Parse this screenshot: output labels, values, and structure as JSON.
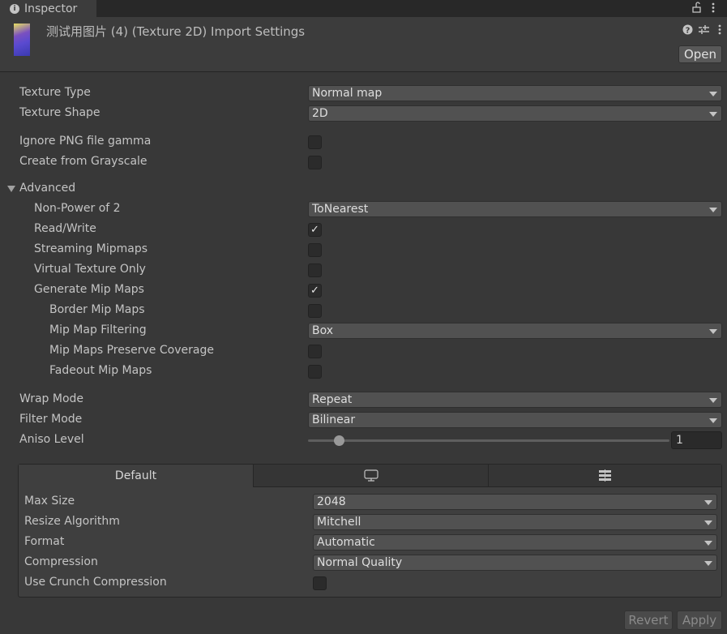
{
  "tab": {
    "title": "Inspector"
  },
  "header": {
    "title": "测试用图片 (4) (Texture 2D) Import Settings",
    "open_label": "Open"
  },
  "fields": {
    "texture_type": {
      "label": "Texture Type",
      "value": "Normal map"
    },
    "texture_shape": {
      "label": "Texture Shape",
      "value": "2D"
    },
    "ignore_png_gamma": {
      "label": "Ignore PNG file gamma",
      "checked": false
    },
    "create_from_grayscale": {
      "label": "Create from Grayscale",
      "checked": false
    },
    "advanced": {
      "label": "Advanced"
    },
    "non_power_of_2": {
      "label": "Non-Power of 2",
      "value": "ToNearest"
    },
    "read_write": {
      "label": "Read/Write",
      "checked": true,
      "mark": "✓"
    },
    "streaming_mipmaps": {
      "label": "Streaming Mipmaps",
      "checked": false
    },
    "virtual_texture_only": {
      "label": "Virtual Texture Only",
      "checked": false
    },
    "generate_mip_maps": {
      "label": "Generate Mip Maps",
      "checked": true,
      "mark": "✓"
    },
    "border_mip_maps": {
      "label": "Border Mip Maps",
      "checked": false
    },
    "mip_map_filtering": {
      "label": "Mip Map Filtering",
      "value": "Box"
    },
    "mip_maps_preserve_coverage": {
      "label": "Mip Maps Preserve Coverage",
      "checked": false
    },
    "fadeout_mip_maps": {
      "label": "Fadeout Mip Maps",
      "checked": false
    },
    "wrap_mode": {
      "label": "Wrap Mode",
      "value": "Repeat"
    },
    "filter_mode": {
      "label": "Filter Mode",
      "value": "Bilinear"
    },
    "aniso_level": {
      "label": "Aniso Level",
      "value": "1",
      "min": 0,
      "max": 16
    }
  },
  "platform": {
    "tabs": [
      {
        "label": "Default"
      },
      {
        "icon": "monitor-icon"
      },
      {
        "icon": "server-icon"
      }
    ],
    "max_size": {
      "label": "Max Size",
      "value": "2048"
    },
    "resize_algorithm": {
      "label": "Resize Algorithm",
      "value": "Mitchell"
    },
    "format": {
      "label": "Format",
      "value": "Automatic"
    },
    "compression": {
      "label": "Compression",
      "value": "Normal Quality"
    },
    "use_crunch": {
      "label": "Use Crunch Compression",
      "checked": false
    }
  },
  "footer": {
    "revert_label": "Revert",
    "apply_label": "Apply"
  }
}
